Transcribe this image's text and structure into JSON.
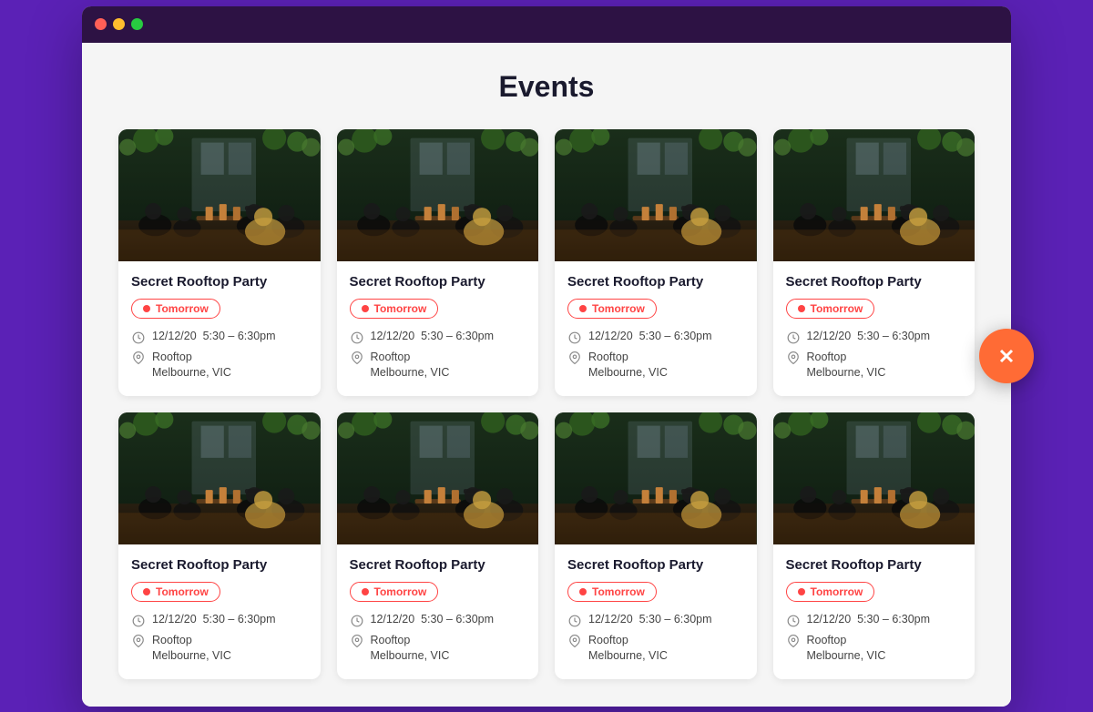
{
  "page": {
    "title": "Events",
    "background_color": "#5B21B6"
  },
  "browser": {
    "titlebar_color": "#2d1244"
  },
  "close_button": {
    "label": "×",
    "color": "#FF6B35"
  },
  "events": [
    {
      "id": 1,
      "name": "Secret Rooftop Party",
      "badge": "Tomorrow",
      "date": "12/12/20",
      "time": "5:30 – 6:30pm",
      "venue": "Rooftop",
      "city": "Melbourne, VIC"
    },
    {
      "id": 2,
      "name": "Secret Rooftop Party",
      "badge": "Tomorrow",
      "date": "12/12/20",
      "time": "5:30 – 6:30pm",
      "venue": "Rooftop",
      "city": "Melbourne, VIC"
    },
    {
      "id": 3,
      "name": "Secret Rooftop Party",
      "badge": "Tomorrow",
      "date": "12/12/20",
      "time": "5:30 – 6:30pm",
      "venue": "Rooftop",
      "city": "Melbourne, VIC"
    },
    {
      "id": 4,
      "name": "Secret Rooftop Party",
      "badge": "Tomorrow",
      "date": "12/12/20",
      "time": "5:30 – 6:30pm",
      "venue": "Rooftop",
      "city": "Melbourne, VIC"
    },
    {
      "id": 5,
      "name": "Secret Rooftop Party",
      "badge": "Tomorrow",
      "date": "12/12/20",
      "time": "5:30 – 6:30pm",
      "venue": "Rooftop",
      "city": "Melbourne, VIC"
    },
    {
      "id": 6,
      "name": "Secret Rooftop Party",
      "badge": "Tomorrow",
      "date": "12/12/20",
      "time": "5:30 – 6:30pm",
      "venue": "Rooftop",
      "city": "Melbourne, VIC"
    },
    {
      "id": 7,
      "name": "Secret Rooftop Party",
      "badge": "Tomorrow",
      "date": "12/12/20",
      "time": "5:30 – 6:30pm",
      "venue": "Rooftop",
      "city": "Melbourne, VIC"
    },
    {
      "id": 8,
      "name": "Secret Rooftop Party",
      "badge": "Tomorrow",
      "date": "12/12/20",
      "time": "5:30 – 6:30pm",
      "venue": "Rooftop",
      "city": "Melbourne, VIC"
    }
  ]
}
